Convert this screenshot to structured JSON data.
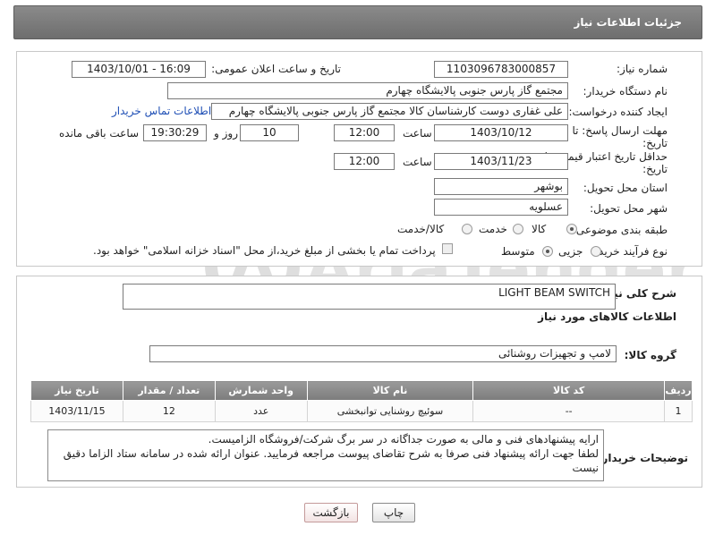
{
  "header": {
    "title": "جزئیات اطلاعات نیاز"
  },
  "form": {
    "need_number_label": "شماره نیاز:",
    "need_number": "1103096783000857",
    "announce_label": "تاریخ و ساعت اعلان عمومی:",
    "announce_value": "1403/10/01 - 16:09",
    "buyer_org_label": "نام دستگاه خریدار:",
    "buyer_org": "مجتمع گاز پارس جنوبی  پالایشگاه چهارم",
    "creator_label": "ایجاد کننده درخواست:",
    "creator": "علی غفاری دوست کارشناسان کالا مجتمع گاز پارس جنوبی  پالایشگاه چهارم",
    "contact_link": "اطلاعات تماس خریدار",
    "reply_deadline_label": "مهلت ارسال پاسخ: تا تاریخ:",
    "reply_date": "1403/10/12",
    "time_label": "ساعت",
    "reply_time": "12:00",
    "days_value": "10",
    "days_label": "روز و",
    "remaining_time": "19:30:29",
    "remaining_label": "ساعت باقی مانده",
    "validity_label": "حداقل تاریخ اعتبار قیمت: تا تاریخ:",
    "validity_date": "1403/11/23",
    "validity_time": "12:00",
    "province_label": "استان محل تحویل:",
    "province": "بوشهر",
    "city_label": "شهر محل تحویل:",
    "city": "عسلویه",
    "category_label": "طبقه بندی موضوعی:",
    "category_options": [
      "کالا",
      "خدمت",
      "کالا/خدمت"
    ],
    "purchase_type_label": "نوع فرآیند خرید :",
    "purchase_options": [
      "جزیی",
      "متوسط"
    ],
    "payment_note": "پرداخت تمام یا بخشی از مبلغ خرید،از محل \"اسناد خزانه اسلامی\" خواهد بود."
  },
  "description": {
    "label": "شرح کلی نیاز:",
    "value": "LIGHT BEAM SWITCH",
    "goods_info_title": "اطلاعات کالاهای مورد نیاز",
    "group_label": "گروه کالا:",
    "group_value": "لامپ و تجهیزات روشنائی"
  },
  "table": {
    "headers": [
      "ردیف",
      "کد کالا",
      "نام کالا",
      "واحد شمارش",
      "تعداد / مقدار",
      "تاریخ نیاز"
    ],
    "rows": [
      [
        "1",
        "--",
        "سوئیچ روشنایی توانبخشی",
        "عدد",
        "12",
        "1403/11/15"
      ]
    ]
  },
  "buyer_notes": {
    "label": "توضیحات خریدار:",
    "line1": "ارایه پیشنهادهای فنی و مالی به صورت جداگانه در سر برگ شرکت/فروشگاه الزامیست.",
    "line2": "لطفا جهت ارائه پیشنهاد فنی صرفا به شرح تقاضای پیوست مراجعه فرمایید. عنوان ارائه شده در سامانه ستاد الزاما دقیق نیست"
  },
  "buttons": {
    "print": "چاپ",
    "back": "بازگشت"
  },
  "watermark": {
    "text": "AriaTender.neT",
    "color": "#dcdcdc"
  }
}
